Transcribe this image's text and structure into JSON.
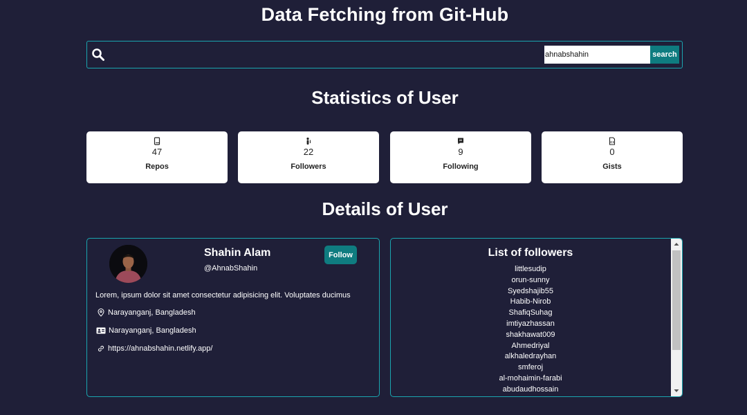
{
  "header": {
    "title": "Data Fetching from Git-Hub"
  },
  "search": {
    "value": "ahnabshahin",
    "button_label": "search",
    "icon": "search-icon"
  },
  "statistics": {
    "title": "Statistics of User",
    "cards": [
      {
        "value": "47",
        "label": "Repos",
        "icon": "book-icon"
      },
      {
        "value": "22",
        "label": "Followers",
        "icon": "people-icon"
      },
      {
        "value": "9",
        "label": "Following",
        "icon": "comment-icon"
      },
      {
        "value": "0",
        "label": "Gists",
        "icon": "file-code-icon"
      }
    ]
  },
  "details": {
    "title": "Details of User",
    "profile": {
      "name": "Shahin Alam",
      "handle": "@AhnabShahin",
      "follow_label": "Follow",
      "bio": "Lorem, ipsum dolor sit amet consectetur adipisicing elit. Voluptates ducimus",
      "location": "Narayanganj, Bangladesh",
      "company": "Narayanganj, Bangladesh",
      "website": "https://ahnabshahin.netlify.app/"
    },
    "followers": {
      "title": "List of followers",
      "items": [
        "littlesudip",
        "orun-sunny",
        "Syedshajib55",
        "Habib-Nirob",
        "ShafiqSuhag",
        "imtiyazhassan",
        "shakhawat009",
        "Ahmedriyal",
        "alkhaledrayhan",
        "smferoj",
        "al-mohaimin-farabi",
        "abudaudhossain"
      ]
    }
  },
  "colors": {
    "background": "#1f1f38",
    "accent": "#0f7c80",
    "border": "#1aa6b0",
    "card": "#ffffff"
  }
}
